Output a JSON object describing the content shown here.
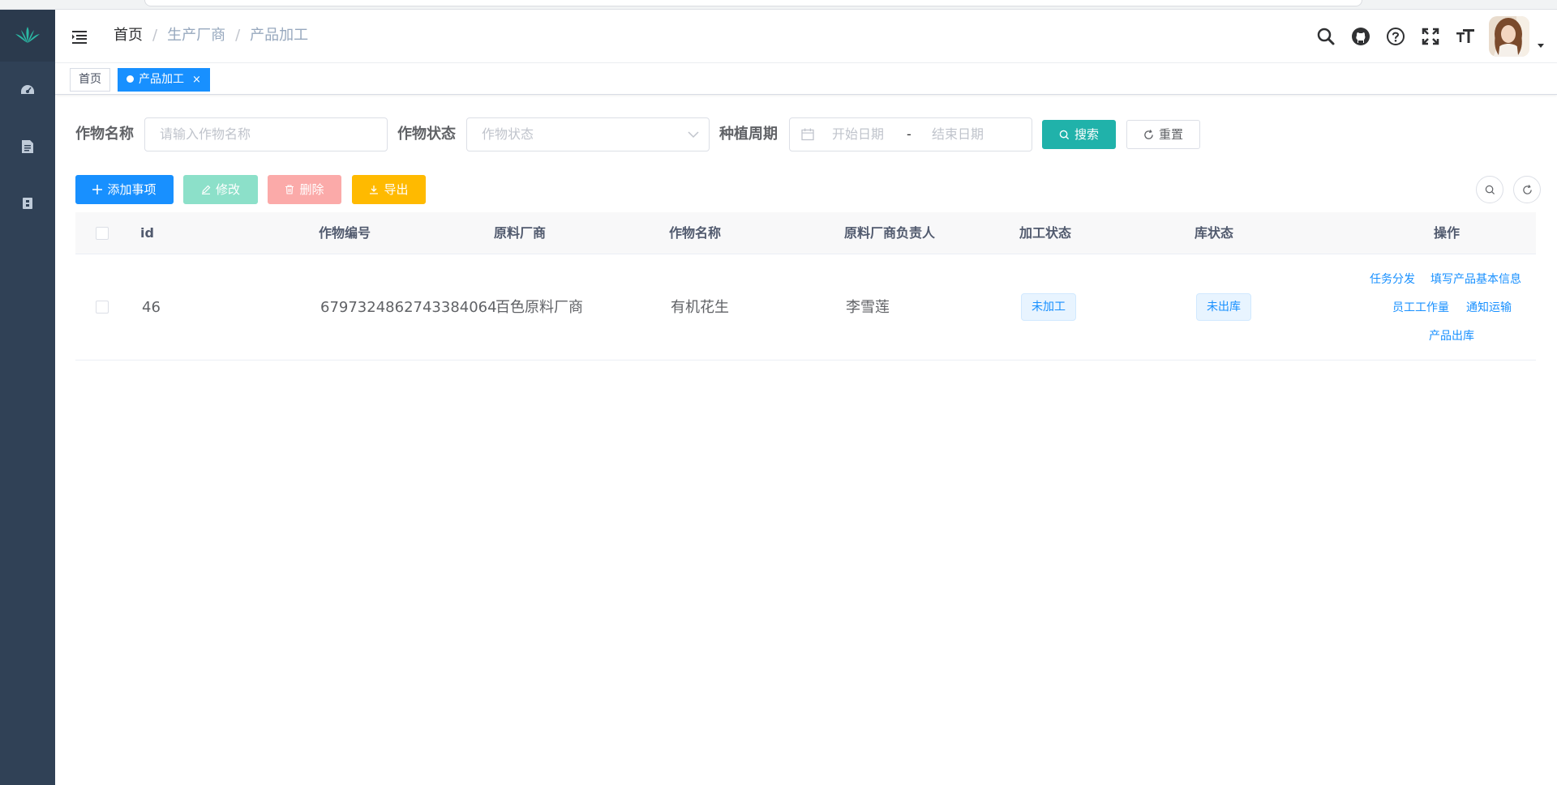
{
  "navbar": {
    "breadcrumb": [
      "首页",
      "生产厂商",
      "产品加工"
    ]
  },
  "tags": {
    "home": "首页",
    "active": "产品加工",
    "close": "×"
  },
  "search": {
    "crop_name_label": "作物名称",
    "crop_name_placeholder": "请输入作物名称",
    "crop_status_label": "作物状态",
    "crop_status_placeholder": "作物状态",
    "period_label": "种植周期",
    "start_placeholder": "开始日期",
    "range_separator": "-",
    "end_placeholder": "结束日期",
    "search_button": "搜索",
    "reset_button": "重置"
  },
  "toolbar": {
    "add": "添加事项",
    "edit": "修改",
    "delete": "删除",
    "export": "导出"
  },
  "table": {
    "headers": [
      "id",
      "作物编号",
      "原料厂商",
      "作物名称",
      "原料厂商负责人",
      "加工状态",
      "库状态",
      "操作"
    ],
    "rows": [
      {
        "id": "46",
        "crop_no": "6797324862743384064",
        "supplier": "百色原料厂商",
        "crop_name": "有机花生",
        "owner": "李雪莲",
        "process_status": "未加工",
        "stock_status": "未出库",
        "ops": [
          "任务分发",
          "填写产品基本信息",
          "员工工作量",
          "通知运输",
          "产品出库"
        ]
      }
    ]
  },
  "colors": {
    "sidebar": "#304156",
    "primary": "#1890ff",
    "success": "#20b2aa",
    "warning": "#ffba00"
  }
}
